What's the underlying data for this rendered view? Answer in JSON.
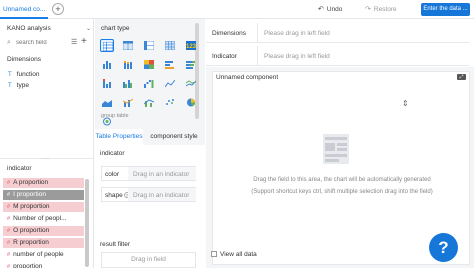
{
  "topbar": {
    "tab_label": "Unnamed co...",
    "add_tab": "+",
    "undo_label": "Undo",
    "restore_label": "Restore",
    "enter_button": "Enter the data ..."
  },
  "left": {
    "dataset_name": "KANO analysis",
    "search_placeholder": "search field",
    "dimensions_title": "Dimensions",
    "dimensions": [
      {
        "type": "T",
        "label": "function"
      },
      {
        "type": "T",
        "label": "type"
      }
    ],
    "indicator_title": "indicator",
    "indicators": [
      {
        "label": "A proportion",
        "style": "red"
      },
      {
        "label": "I proportion",
        "style": "grey"
      },
      {
        "label": "M proportion",
        "style": "red"
      },
      {
        "label": "Number of peopl...",
        "style": "plain"
      },
      {
        "label": "O proportion",
        "style": "red"
      },
      {
        "label": "R proportion",
        "style": "red"
      },
      {
        "label": "number of people",
        "style": "plain"
      },
      {
        "label": "proportion",
        "style": "plain"
      }
    ]
  },
  "chart_panel": {
    "title": "chart type",
    "group_label": "group table",
    "tab_properties": "Table Properties",
    "tab_style": "component style",
    "indicator_title": "indicator",
    "color_label": "color",
    "color_drop": "Drag in an indicator",
    "shape_label": "shape",
    "shape_drop": "Drag in an indicator",
    "result_filter_title": "result filter",
    "result_filter_drop": "Drag in field"
  },
  "right": {
    "dimensions_label": "Dimensions",
    "dimensions_placeholder": "Please drag in left field",
    "indicator_label": "Indicator",
    "indicator_placeholder": "Please drag in left field",
    "component_title": "Unnamed component",
    "empty_line1": "Drag the field to this area, the chart will be automatically generated",
    "empty_line2": "(Support shortcut keys ctrl, shift multiple selection drag into the field)",
    "view_all": "View all data"
  },
  "help_fab": "?"
}
